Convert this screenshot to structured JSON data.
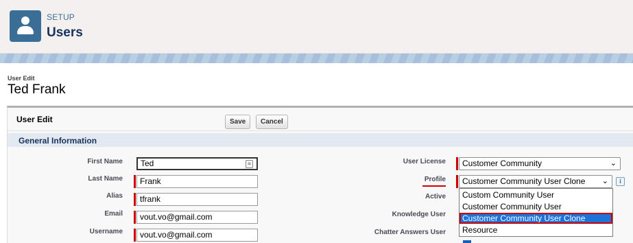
{
  "header": {
    "kicker": "SETUP",
    "title": "Users",
    "icon": "user-icon"
  },
  "page": {
    "kicker": "User Edit",
    "name": "Ted Frank"
  },
  "panel": {
    "title": "User Edit",
    "save_label": "Save",
    "cancel_label": "Cancel",
    "section_title": "General Information"
  },
  "left_fields": {
    "first_name": {
      "label": "First Name",
      "value": "Ted"
    },
    "last_name": {
      "label": "Last Name",
      "value": "Frank"
    },
    "alias": {
      "label": "Alias",
      "value": "tfrank"
    },
    "email": {
      "label": "Email",
      "value": "vout.vo@gmail.com"
    },
    "username": {
      "label": "Username",
      "value": "vout.vo@gmail.com"
    }
  },
  "right_fields": {
    "user_license": {
      "label": "User License",
      "value": "Customer Community"
    },
    "profile": {
      "label": "Profile",
      "value": "Customer Community User Clone"
    },
    "active": {
      "label": "Active"
    },
    "knowledge_user": {
      "label": "Knowledge User"
    },
    "chatter_answers_user": {
      "label": "Chatter Answers User"
    }
  },
  "profile_options": [
    "Custom Community User",
    "Customer Community User",
    "Customer Community User Clone",
    "Resource"
  ],
  "colors": {
    "required": "#cc0000",
    "selected_option": "#1e73d8",
    "setup_icon": "#3a6e96"
  }
}
